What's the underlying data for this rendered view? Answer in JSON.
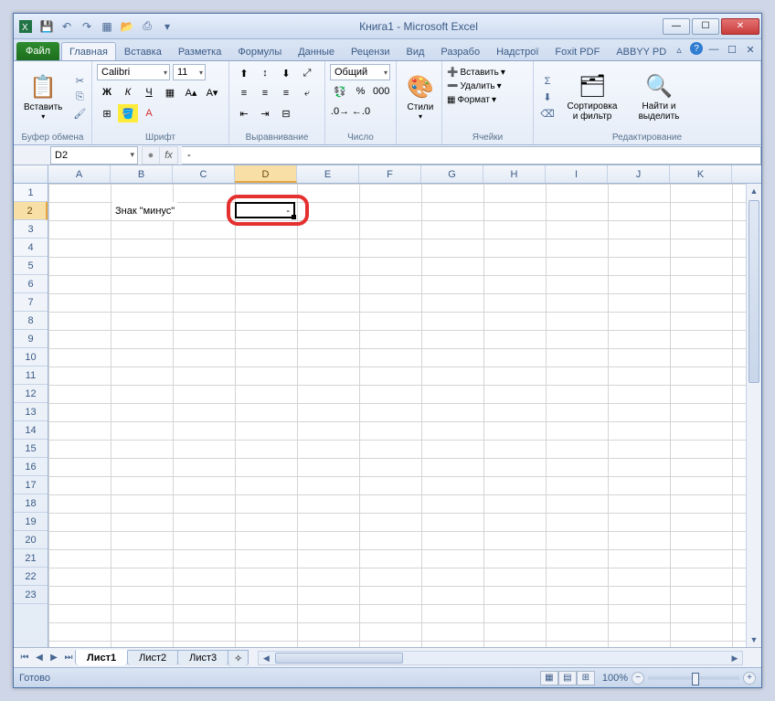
{
  "title": "Книга1 - Microsoft Excel",
  "qat": {
    "save": "💾",
    "undo": "↶",
    "redo": "↷",
    "new": "▦",
    "open": "📂",
    "print": "⎙"
  },
  "tabs": {
    "file": "Файл",
    "items": [
      "Главная",
      "Вставка",
      "Разметка",
      "Формулы",
      "Данные",
      "Рецензи",
      "Вид",
      "Разрабо",
      "Надстрої",
      "Foxit PDF",
      "ABBYY PD"
    ],
    "active": 0
  },
  "ribbon": {
    "clipboard": {
      "paste": "Вставить",
      "label": "Буфер обмена"
    },
    "font": {
      "name": "Calibri",
      "size": "11",
      "label": "Шрифт",
      "bold": "Ж",
      "italic": "К",
      "underline": "Ч"
    },
    "align": {
      "label": "Выравнивание"
    },
    "number": {
      "format": "Общий",
      "label": "Число"
    },
    "styles": {
      "btn": "Стили"
    },
    "cells": {
      "insert": "Вставить",
      "delete": "Удалить",
      "format": "Формат",
      "label": "Ячейки"
    },
    "editing": {
      "sort": "Сортировка и фильтр",
      "find": "Найти и выделить",
      "label": "Редактирование"
    }
  },
  "fbar": {
    "name": "D2",
    "fx": "fx",
    "value": "-"
  },
  "columns": [
    "A",
    "B",
    "C",
    "D",
    "E",
    "F",
    "G",
    "H",
    "I",
    "J",
    "K"
  ],
  "rows": 23,
  "sel": {
    "col": "D",
    "row": 2
  },
  "cellB2": "Знак \"минус\"",
  "cellD2": "-",
  "sheets": {
    "nav": [
      "⏮",
      "◀",
      "▶",
      "⏭"
    ],
    "items": [
      "Лист1",
      "Лист2",
      "Лист3"
    ],
    "active": 0,
    "new": "✧"
  },
  "status": {
    "ready": "Готово",
    "zoom": "100%"
  }
}
